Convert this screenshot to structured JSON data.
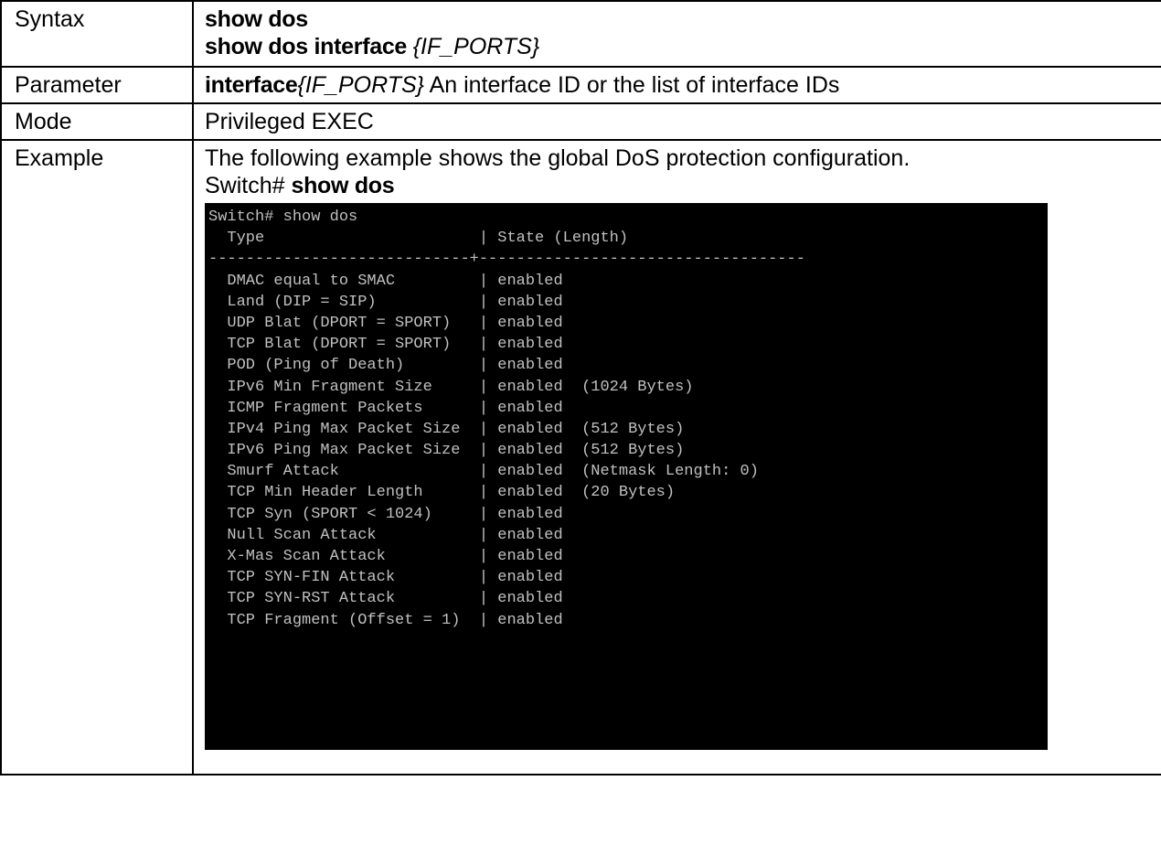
{
  "rows": {
    "syntax": {
      "label": "Syntax",
      "line1": "show dos",
      "line2_bold": "show dos interface ",
      "line2_ital": "{IF_PORTS}"
    },
    "parameter": {
      "label": "Parameter",
      "bold": "interface",
      "ital": "{IF_PORTS}",
      "text": " An interface ID or the list of interface IDs"
    },
    "mode": {
      "label": "Mode",
      "text": "Privileged EXEC"
    },
    "example": {
      "label": "Example",
      "description": "The following example shows the global DoS protection configuration.",
      "prompt": "Switch# ",
      "command": "show dos"
    }
  },
  "terminal": {
    "lines": [
      "Switch# show dos",
      "  Type                       | State (Length)",
      "----------------------------+-----------------------------------",
      "  DMAC equal to SMAC         | enabled",
      "  Land (DIP = SIP)           | enabled",
      "  UDP Blat (DPORT = SPORT)   | enabled",
      "  TCP Blat (DPORT = SPORT)   | enabled",
      "  POD (Ping of Death)        | enabled",
      "  IPv6 Min Fragment Size     | enabled  (1024 Bytes)",
      "  ICMP Fragment Packets      | enabled",
      "  IPv4 Ping Max Packet Size  | enabled  (512 Bytes)",
      "  IPv6 Ping Max Packet Size  | enabled  (512 Bytes)",
      "  Smurf Attack               | enabled  (Netmask Length: 0)",
      "  TCP Min Header Length      | enabled  (20 Bytes)",
      "  TCP Syn (SPORT < 1024)     | enabled",
      "  Null Scan Attack           | enabled",
      "  X-Mas Scan Attack          | enabled",
      "  TCP SYN-FIN Attack         | enabled",
      "  TCP SYN-RST Attack         | enabled",
      "  TCP Fragment (Offset = 1)  | enabled"
    ]
  }
}
